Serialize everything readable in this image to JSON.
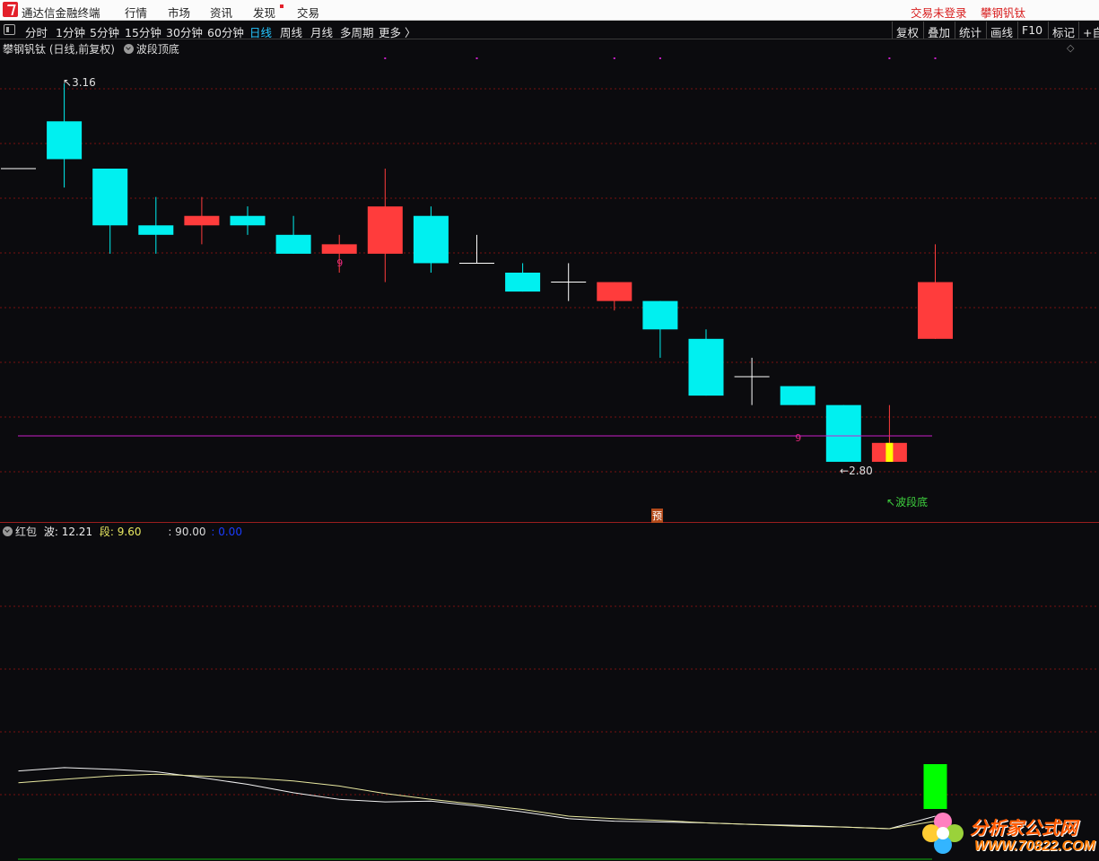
{
  "menubar": {
    "app_title": "通达信金融终端",
    "items": [
      "行情",
      "市场",
      "资讯",
      "发现",
      "交易"
    ],
    "login_status": "交易未登录",
    "stock_name": "攀钢钒钛"
  },
  "toolbar": {
    "periods": [
      "分时",
      "1分钟",
      "5分钟",
      "15分钟",
      "30分钟",
      "60分钟",
      "日线",
      "周线",
      "月线",
      "多周期",
      "更多 〉"
    ],
    "active_period": "日线",
    "right_buttons": [
      "复权",
      "叠加",
      "统计",
      "画线",
      "F10",
      "标记",
      "+自"
    ]
  },
  "main_chart": {
    "title": "攀钢钒钛 (日线,前复权)",
    "indicator": "波段顶底",
    "high_label": "3.16",
    "low_label": "2.80",
    "bottom_signal": "波段底",
    "nine_label": "9",
    "pre_marker": "预",
    "colors": {
      "up": "#ff3c3c",
      "down": "#00f0f0",
      "doji": "#ffffff",
      "signal": "#ffff00",
      "grid": "#7a1010",
      "magenta": "#c81fc8"
    },
    "candles": [
      {
        "o": 3.07,
        "h": 3.07,
        "l": 3.07,
        "c": 3.07
      },
      {
        "o": 3.12,
        "h": 3.16,
        "l": 3.05,
        "c": 3.08
      },
      {
        "o": 3.07,
        "h": 3.07,
        "l": 2.98,
        "c": 3.01
      },
      {
        "o": 3.01,
        "h": 3.04,
        "l": 2.98,
        "c": 3.0
      },
      {
        "o": 3.01,
        "h": 3.04,
        "l": 2.99,
        "c": 3.02
      },
      {
        "o": 3.02,
        "h": 3.03,
        "l": 3.0,
        "c": 3.01
      },
      {
        "o": 3.0,
        "h": 3.02,
        "l": 2.98,
        "c": 2.98
      },
      {
        "o": 2.98,
        "h": 3.0,
        "l": 2.96,
        "c": 2.99
      },
      {
        "o": 2.98,
        "h": 3.07,
        "l": 2.95,
        "c": 3.03
      },
      {
        "o": 3.02,
        "h": 3.03,
        "l": 2.96,
        "c": 2.97
      },
      {
        "o": 2.97,
        "h": 3.0,
        "l": 2.97,
        "c": 2.97
      },
      {
        "o": 2.96,
        "h": 2.97,
        "l": 2.94,
        "c": 2.94
      },
      {
        "o": 2.95,
        "h": 2.97,
        "l": 2.93,
        "c": 2.95
      },
      {
        "o": 2.93,
        "h": 2.95,
        "l": 2.92,
        "c": 2.95
      },
      {
        "o": 2.93,
        "h": 2.93,
        "l": 2.87,
        "c": 2.9
      },
      {
        "o": 2.89,
        "h": 2.9,
        "l": 2.83,
        "c": 2.83
      },
      {
        "o": 2.85,
        "h": 2.87,
        "l": 2.82,
        "c": 2.85
      },
      {
        "o": 2.84,
        "h": 2.84,
        "l": 2.82,
        "c": 2.82
      },
      {
        "o": 2.82,
        "h": 2.82,
        "l": 2.8,
        "c": 2.76
      },
      {
        "o": 2.76,
        "h": 2.82,
        "l": 2.76,
        "c": 2.78
      },
      {
        "o": 2.89,
        "h": 2.99,
        "l": 2.89,
        "c": 2.95
      }
    ],
    "signal_bar_index": 19,
    "nine_indices": [
      7,
      17
    ],
    "top_dot_indices": [
      8,
      10,
      13,
      14,
      19,
      20
    ]
  },
  "sub_chart": {
    "name": "红包",
    "wave_label": "波:",
    "wave_value": "12.21",
    "seg_label": "段:",
    "seg_value": "9.60",
    "level_label": ": 90.00",
    "zero_label": ": 0.00",
    "colors": {
      "white_line": "#f2f2f2",
      "yellow_line": "#e8e8a0",
      "level_line": "#c81fc8",
      "zero_line": "#10b010",
      "bar": "#00ff00"
    },
    "wave_series": [
      84,
      88,
      86,
      83,
      76,
      68,
      58,
      50,
      47,
      48,
      42,
      35,
      27,
      24,
      23,
      22,
      20,
      19,
      17,
      15,
      30
    ],
    "seg_series": [
      70,
      74,
      78,
      80,
      78,
      76,
      72,
      66,
      57,
      50,
      44,
      38,
      30,
      27,
      25,
      22,
      20,
      18,
      17,
      15,
      24
    ],
    "bar_value": 70
  },
  "watermark": {
    "line1": "分析家公式网",
    "line2": "WWW.70822.COM"
  }
}
